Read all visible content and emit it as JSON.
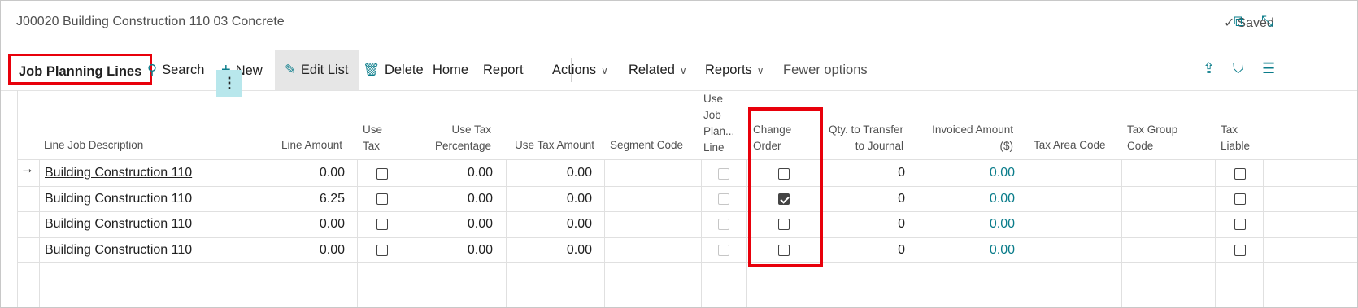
{
  "header": {
    "title": "J00020 Building Construction 110 03 Concrete",
    "saved": "Saved"
  },
  "toolbar": {
    "page_name": "Job Planning Lines",
    "search": "Search",
    "new": "New",
    "edit_list": "Edit List",
    "delete": "Delete",
    "home": "Home",
    "report": "Report",
    "actions": "Actions",
    "related": "Related",
    "reports": "Reports",
    "fewer": "Fewer options"
  },
  "columns": {
    "line_job_description": "Line Job Description",
    "line_amount": "Line Amount",
    "use_tax_1": "Use",
    "use_tax_2": "Tax",
    "use_tax_pct_1": "Use Tax",
    "use_tax_pct_2": "Percentage",
    "use_tax_amount": "Use Tax Amount",
    "segment_code": "Segment Code",
    "use_job_1": "Use",
    "use_job_2": "Job",
    "use_job_3": "Plan...",
    "use_job_4": "Line",
    "change_order_1": "Change",
    "change_order_2": "Order",
    "qty_transfer_1": "Qty. to Transfer",
    "qty_transfer_2": "to Journal",
    "invoiced_1": "Invoiced Amount",
    "invoiced_2": "($)",
    "tax_area_code": "Tax Area Code",
    "tax_group_1": "Tax Group",
    "tax_group_2": "Code",
    "tax_liable_1": "Tax",
    "tax_liable_2": "Liable"
  },
  "rows": [
    {
      "description": "Building Construction 110",
      "line_amount": "0.00",
      "use_tax_pct": "0.00",
      "use_tax_amount": "0.00",
      "change_order": false,
      "qty": "0",
      "invoiced": "0.00"
    },
    {
      "description": "Building Construction 110",
      "line_amount": "6.25",
      "use_tax_pct": "0.00",
      "use_tax_amount": "0.00",
      "change_order": true,
      "qty": "0",
      "invoiced": "0.00"
    },
    {
      "description": "Building Construction 110",
      "line_amount": "0.00",
      "use_tax_pct": "0.00",
      "use_tax_amount": "0.00",
      "change_order": false,
      "qty": "0",
      "invoiced": "0.00"
    },
    {
      "description": "Building Construction 110",
      "line_amount": "0.00",
      "use_tax_pct": "0.00",
      "use_tax_amount": "0.00",
      "change_order": false,
      "qty": "0",
      "invoiced": "0.00"
    }
  ],
  "colors": {
    "accent": "#0a7c8a",
    "highlight": "#e8000b"
  }
}
